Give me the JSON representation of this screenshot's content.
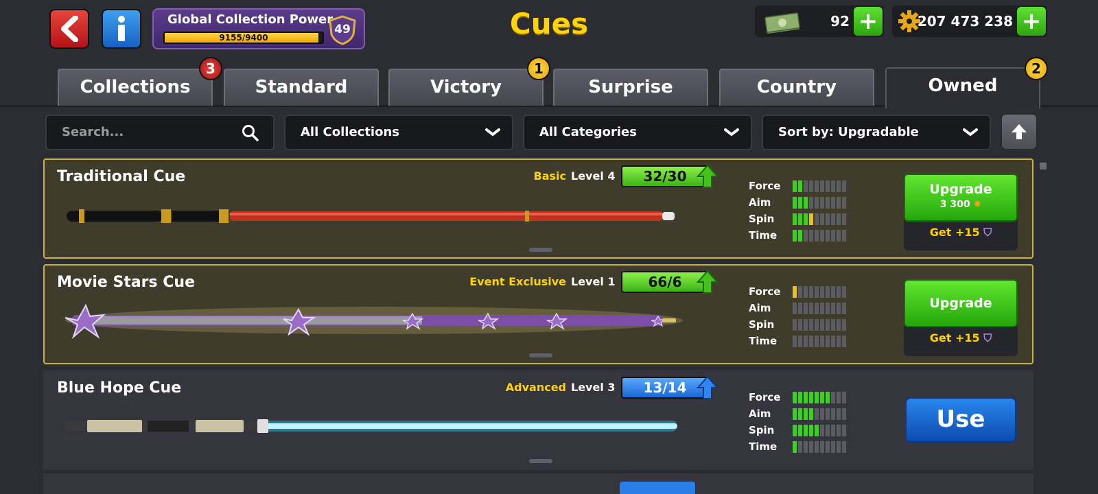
{
  "header": {
    "title": "Cues",
    "back_icon": "back-arrow-icon",
    "info_icon": "info-icon",
    "collection_power": {
      "label": "Global Collection Power",
      "progress_text": "9155/9400",
      "progress_fraction": 0.974,
      "level": "49"
    },
    "cash": {
      "value": "92",
      "icon": "cash-icon"
    },
    "coins": {
      "value": "207 473 238",
      "icon": "coins-gear-icon"
    }
  },
  "tabs": [
    {
      "label": "Collections",
      "badge": "3",
      "badge_color": "red"
    },
    {
      "label": "Standard",
      "badge": ""
    },
    {
      "label": "Victory",
      "badge": "1",
      "badge_color": "yellow"
    },
    {
      "label": "Surprise",
      "badge": ""
    },
    {
      "label": "Country",
      "badge": ""
    },
    {
      "label": "Owned",
      "badge": "2",
      "badge_color": "yellow",
      "active": true
    }
  ],
  "filters": {
    "search_placeholder": "Search...",
    "collections": "All Collections",
    "categories": "All Categories",
    "sort": "Sort by: Upgradable"
  },
  "stat_labels": [
    "Force",
    "Aim",
    "Spin",
    "Time"
  ],
  "cues": [
    {
      "name": "Traditional Cue",
      "rarity": "Basic",
      "level": "Level 4",
      "progress": "32/30",
      "progress_color": "green",
      "stats": {
        "force": 2,
        "aim": 3,
        "spin": 3.5,
        "time": 2
      },
      "action": "Upgrade",
      "upgrade_cost": "3 300",
      "get_plus": "Get +15"
    },
    {
      "name": "Movie Stars Cue",
      "rarity": "Event Exclusive",
      "level": "Level 1",
      "progress": "66/6",
      "progress_color": "green",
      "stats": {
        "force": 0.5,
        "aim": 0,
        "spin": 0,
        "time": 0
      },
      "action": "Upgrade",
      "upgrade_cost": "",
      "get_plus": "Get +15"
    },
    {
      "name": "Blue Hope Cue",
      "rarity": "Advanced",
      "level": "Level 3",
      "progress": "13/14",
      "progress_color": "blue",
      "stats": {
        "force": 7,
        "aim": 4,
        "spin": 5,
        "time": 1
      },
      "action": "Use"
    }
  ],
  "colors": {
    "background": "#2c2d33",
    "title_yellow": "#ffd400",
    "upgrade_green": "#3bb416",
    "use_blue": "#1b68d6",
    "stat_green": "#36d51b",
    "stat_yellow": "#e6c319",
    "card_gold_border": "#c9b43a"
  }
}
